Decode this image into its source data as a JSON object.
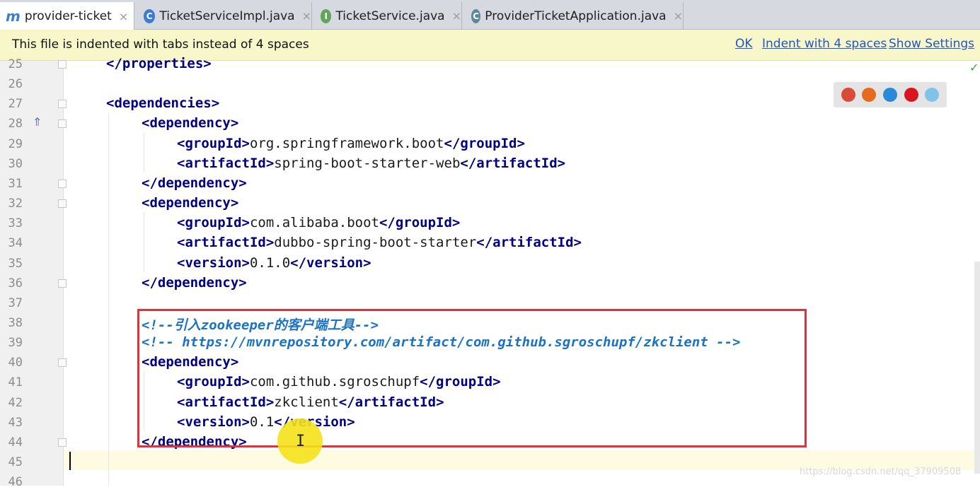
{
  "tabs": [
    {
      "label": "provider-ticket",
      "icon": "maven-icon",
      "active": true
    },
    {
      "label": "TicketServiceImpl.java",
      "icon": "class-icon",
      "active": false
    },
    {
      "label": "TicketService.java",
      "icon": "interface-icon",
      "active": false
    },
    {
      "label": "ProviderTicketApplication.java",
      "icon": "spring-app-icon",
      "active": false
    }
  ],
  "tab_close_glyph": "×",
  "notification": {
    "message": "This file is indented with tabs instead of 4 spaces",
    "ok": "OK",
    "indent": "Indent with 4 spaces",
    "settings": "Show Settings"
  },
  "lines": [
    {
      "n": "25",
      "indent": 1,
      "parts": [
        {
          "t": "</properties>",
          "c": "tag"
        }
      ]
    },
    {
      "n": "26",
      "indent": 0,
      "parts": []
    },
    {
      "n": "27",
      "indent": 1,
      "parts": [
        {
          "t": "<dependencies>",
          "c": "tag"
        }
      ]
    },
    {
      "n": "28",
      "indent": 2,
      "parts": [
        {
          "t": "<dependency>",
          "c": "tag"
        }
      ]
    },
    {
      "n": "29",
      "indent": 3,
      "parts": [
        {
          "t": "<groupId>",
          "c": "tag"
        },
        {
          "t": "org.springframework.boot",
          "c": "txt"
        },
        {
          "t": "</groupId>",
          "c": "tag"
        }
      ]
    },
    {
      "n": "30",
      "indent": 3,
      "parts": [
        {
          "t": "<artifactId>",
          "c": "tag"
        },
        {
          "t": "spring-boot-starter-web",
          "c": "txt"
        },
        {
          "t": "</artifactId>",
          "c": "tag"
        }
      ]
    },
    {
      "n": "31",
      "indent": 2,
      "parts": [
        {
          "t": "</dependency>",
          "c": "tag"
        }
      ]
    },
    {
      "n": "32",
      "indent": 2,
      "parts": [
        {
          "t": "<dependency>",
          "c": "tag"
        }
      ]
    },
    {
      "n": "33",
      "indent": 3,
      "parts": [
        {
          "t": "<groupId>",
          "c": "tag"
        },
        {
          "t": "com.alibaba.boot",
          "c": "txt"
        },
        {
          "t": "</groupId>",
          "c": "tag"
        }
      ]
    },
    {
      "n": "34",
      "indent": 3,
      "parts": [
        {
          "t": "<artifactId>",
          "c": "tag"
        },
        {
          "t": "dubbo-spring-boot-starter",
          "c": "txt"
        },
        {
          "t": "</artifactId>",
          "c": "tag"
        }
      ]
    },
    {
      "n": "35",
      "indent": 3,
      "parts": [
        {
          "t": "<version>",
          "c": "tag"
        },
        {
          "t": "0.1.0",
          "c": "txt"
        },
        {
          "t": "</version>",
          "c": "tag"
        }
      ]
    },
    {
      "n": "36",
      "indent": 2,
      "parts": [
        {
          "t": "</dependency>",
          "c": "tag"
        }
      ]
    },
    {
      "n": "37",
      "indent": 0,
      "parts": []
    },
    {
      "n": "38",
      "indent": 2,
      "parts": [
        {
          "t": "<!--引入zookeeper的客户端工具-->",
          "c": "cmt"
        }
      ]
    },
    {
      "n": "39",
      "indent": 2,
      "parts": [
        {
          "t": "<!-- https://mvnrepository.com/artifact/com.github.sgroschupf/zkclient -->",
          "c": "cmt"
        }
      ]
    },
    {
      "n": "40",
      "indent": 2,
      "parts": [
        {
          "t": "<dependency>",
          "c": "tag"
        }
      ]
    },
    {
      "n": "41",
      "indent": 3,
      "parts": [
        {
          "t": "<groupId>",
          "c": "tag"
        },
        {
          "t": "com.github.sgroschupf",
          "c": "txt"
        },
        {
          "t": "</groupId>",
          "c": "tag"
        }
      ]
    },
    {
      "n": "42",
      "indent": 3,
      "parts": [
        {
          "t": "<artifactId>",
          "c": "tag"
        },
        {
          "t": "zkclient",
          "c": "txt"
        },
        {
          "t": "</artifactId>",
          "c": "tag"
        }
      ]
    },
    {
      "n": "43",
      "indent": 3,
      "parts": [
        {
          "t": "<version>",
          "c": "tag"
        },
        {
          "t": "0.1",
          "c": "txt"
        },
        {
          "t": "</version>",
          "c": "tag"
        }
      ]
    },
    {
      "n": "44",
      "indent": 2,
      "parts": [
        {
          "t": "</dependency>",
          "c": "tag"
        }
      ]
    },
    {
      "n": "45",
      "indent": 0,
      "parts": []
    },
    {
      "n": "46",
      "indent": 0,
      "parts": []
    }
  ],
  "browser_icons": [
    "chrome-icon",
    "firefox-icon",
    "safari-icon",
    "opera-icon",
    "ie-icon"
  ],
  "browser_colors": [
    "#d94a38",
    "#e66a1f",
    "#2a8ad8",
    "#d8161e",
    "#7fc4e8"
  ],
  "check_glyph": "✓",
  "ibeam_glyph": "I",
  "watermark": "https://blog.csdn.net/qq_37909508",
  "colors": {
    "highlight_border": "#e0323a",
    "tag": "#000080",
    "comment": "#1c73c2",
    "link": "#2255c6"
  }
}
